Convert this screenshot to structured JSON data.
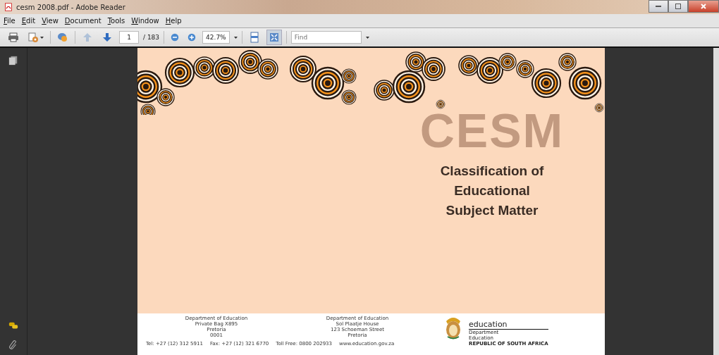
{
  "window": {
    "title": "cesm 2008.pdf - Adobe Reader"
  },
  "menu": [
    "File",
    "Edit",
    "View",
    "Document",
    "Tools",
    "Window",
    "Help"
  ],
  "toolbar": {
    "page_number": "1",
    "page_count": "/ 183",
    "zoom": "42.7%",
    "find": {
      "placeholder": "Find"
    },
    "buttons": [
      {
        "kind": "print",
        "disabled": false,
        "selected": false
      },
      {
        "kind": "tools",
        "disabled": false,
        "selected": false
      },
      {
        "kind": "comment",
        "disabled": false,
        "selected": false
      },
      {
        "kind": "prev",
        "disabled": true,
        "selected": false
      },
      {
        "kind": "next",
        "disabled": false,
        "selected": false
      }
    ],
    "view_buttons": [
      {
        "kind": "fit",
        "selected": false
      },
      {
        "kind": "full",
        "selected": true
      }
    ]
  },
  "document": {
    "watermark": "CESM",
    "title": [
      "Classification of",
      "Educational",
      "Subject Matter"
    ],
    "address_1": [
      "Department of Education",
      "Private Bag X895",
      "Pretoria",
      "0001"
    ],
    "address_2": [
      "Department of Education",
      "Sol Plaatje House",
      "123 Schoeman Street",
      "Pretoria"
    ],
    "contacts": [
      "Tel: +27 (12) 312 5911",
      "Fax: +27 (12) 321 6770",
      "Toll Free: 0800 202933",
      "www.education.gov.za"
    ],
    "logo": {
      "name": "education",
      "lines": [
        "Department",
        "Education",
        "REPUBLIC OF SOUTH AFRICA"
      ]
    }
  }
}
